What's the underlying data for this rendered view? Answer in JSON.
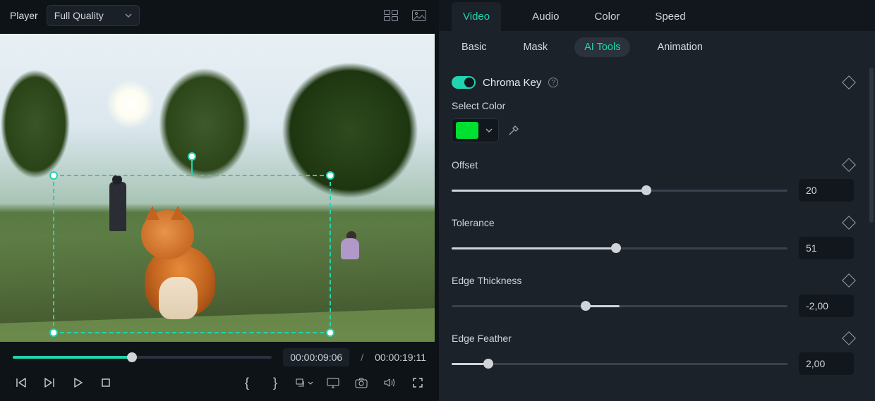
{
  "player": {
    "label": "Player",
    "quality": "Full Quality",
    "timeline_percent": 46,
    "time_current": "00:00:09:06",
    "time_total": "00:00:19:11"
  },
  "inspector": {
    "top_tabs": {
      "video": "Video",
      "audio": "Audio",
      "color": "Color",
      "speed": "Speed"
    },
    "sub_tabs": {
      "basic": "Basic",
      "mask": "Mask",
      "ai_tools": "AI Tools",
      "animation": "Animation"
    },
    "chroma": {
      "title": "Chroma Key",
      "select_label": "Select Color",
      "color_hex": "#00e030",
      "offset_label": "Offset",
      "offset_value": "20",
      "offset_percent": 58,
      "tolerance_label": "Tolerance",
      "tolerance_value": "51",
      "tolerance_percent": 49,
      "edge_thickness_label": "Edge Thickness",
      "edge_thickness_value": "-2,00",
      "edge_thickness_percent": 40,
      "edge_feather_label": "Edge Feather",
      "edge_feather_value": "2,00",
      "edge_feather_percent": 11
    }
  }
}
